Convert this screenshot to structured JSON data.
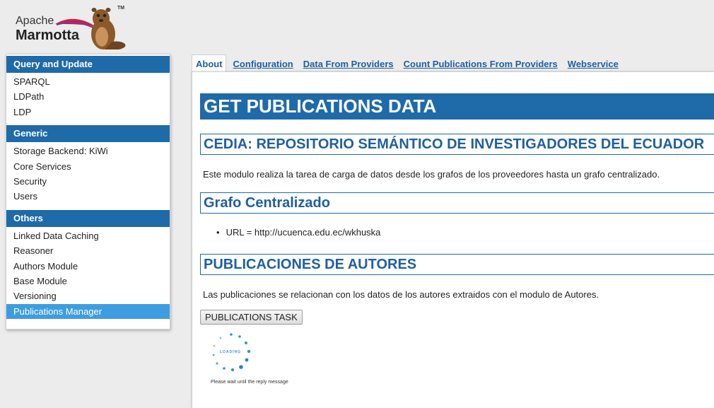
{
  "logo": {
    "line1": "Apache",
    "line2": "Marmotta",
    "tm": "TM",
    "brand_color": "#8b5a2b"
  },
  "sidebar": {
    "sections": [
      {
        "title": "Query and Update",
        "items": [
          "SPARQL",
          "LDPath",
          "LDP"
        ]
      },
      {
        "title": "Generic",
        "items": [
          "Storage Backend: KiWi",
          "Core Services",
          "Security",
          "Users"
        ]
      },
      {
        "title": "Others",
        "items": [
          "Linked Data Caching",
          "Reasoner",
          "Authors Module",
          "Base Module",
          "Versioning",
          "Publications Manager"
        ]
      }
    ],
    "active_item": "Publications Manager"
  },
  "tabs": [
    "About",
    "Configuration",
    "Data From Providers",
    "Count Publications From Providers",
    "Webservice"
  ],
  "active_tab": "About",
  "main": {
    "title": "GET PUBLICATIONS DATA",
    "cedia_heading": "CEDIA: REPOSITORIO SEMÁNTICO DE INVESTIGADORES DEL ECUADOR",
    "description": "Este modulo realiza la tarea de carga de datos desde los grafos de los proveedores hasta un grafo centralizado.",
    "grafo_heading": "Grafo Centralizado",
    "url_item": "URL = http://ucuenca.edu.ec/wkhuska",
    "pub_heading": "PUBLICACIONES DE AUTORES",
    "pub_description": "Las publicaciones se relacionan con los datos de los autores extraidos con el modulo de Autores.",
    "task_button": "PUBLICATIONS TASK",
    "loading_label": "LOADING",
    "loading_message": "Please wait until the reply message"
  },
  "colors": {
    "header_blue": "#1f6aa8",
    "active_item_blue": "#3d9de0",
    "link_blue": "#1f5fa0",
    "page_bg": "#ececec"
  }
}
